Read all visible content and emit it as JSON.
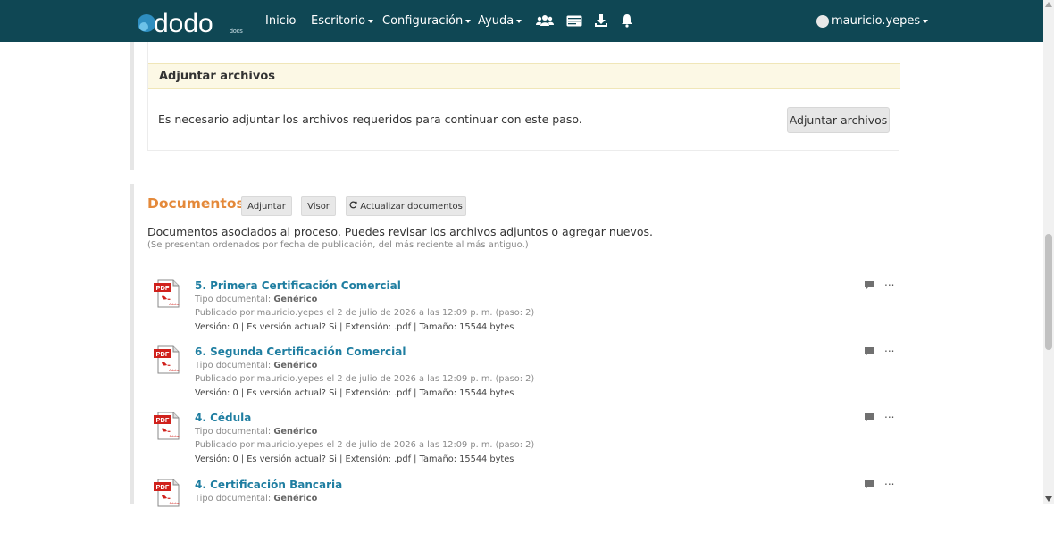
{
  "nav": {
    "brand": "dodo",
    "brand_sub": "docs",
    "items": [
      {
        "label": "Inicio",
        "caret": false
      },
      {
        "label": "Escritorio",
        "caret": true
      },
      {
        "label": "Configuración",
        "caret": true
      },
      {
        "label": "Ayuda",
        "caret": true
      }
    ],
    "icons": [
      "users-icon",
      "id-card-icon",
      "download-icon",
      "bell-icon"
    ],
    "user": "mauricio.yepes",
    "color": "#0f4754"
  },
  "upload_panel": {
    "title": "Adjuntar archivos",
    "message": "Es necesario adjuntar los archivos requeridos para continuar con este paso.",
    "button": "Adjuntar archivos"
  },
  "documents": {
    "title": "Documentos",
    "buttons": {
      "attach": "Adjuntar",
      "viewer": "Visor",
      "refresh": "Actualizar documentos"
    },
    "description": "Documentos asociados al proceso. Puedes revisar los archivos adjuntos o agregar nuevos.",
    "note": "(Se presentan ordenados por fecha de publicación, del más reciente al más antiguo.)",
    "type_label": "Tipo documental:",
    "items": [
      {
        "title": "5. Primera Certificación Comercial",
        "type": "Genérico",
        "published": "Publicado por mauricio.yepes el 2 de julio de 2026 a las 12:09 p. m. (paso: 2)",
        "meta": "Versión: 0 | Es versión actual? Si | Extensión: .pdf | Tamaño: 15544 bytes"
      },
      {
        "title": "6. Segunda Certificación Comercial",
        "type": "Genérico",
        "published": "Publicado por mauricio.yepes el 2 de julio de 2026 a las 12:09 p. m. (paso: 2)",
        "meta": "Versión: 0 | Es versión actual? Si | Extensión: .pdf | Tamaño: 15544 bytes"
      },
      {
        "title": "4. Cédula",
        "type": "Genérico",
        "published": "Publicado por mauricio.yepes el 2 de julio de 2026 a las 12:09 p. m. (paso: 2)",
        "meta": "Versión: 0 | Es versión actual? Si | Extensión: .pdf | Tamaño: 15544 bytes"
      },
      {
        "title": "4. Certificación Bancaria",
        "type": "Genérico",
        "published": "",
        "meta": ""
      }
    ],
    "more_label": "..."
  }
}
